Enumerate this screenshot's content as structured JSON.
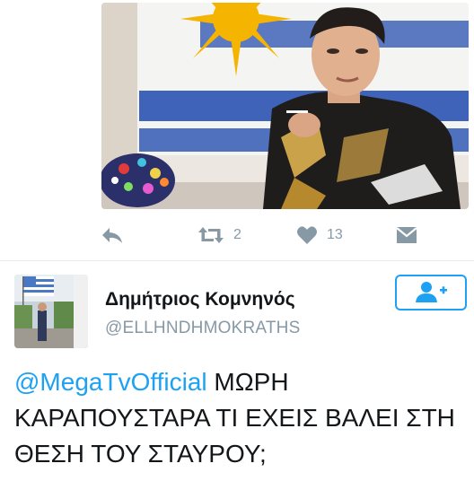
{
  "tweet_actions": {
    "retweet_count": "2",
    "like_count": "13"
  },
  "next_tweet": {
    "display_name": "Δημήτριος Κομνηνός",
    "handle": "@ELLHNDHMOKRATHS",
    "mention": "@MegaTvOfficial",
    "text": " ΜΩΡΗ ΚΑΡΑΠΟΥΣΤΑΡΑ ΤΙ ΕΧΕΙΣ ΒΑΛΕΙ ΣΤΗ ΘΕΣΗ ΤΟΥ ΣΤΑΥΡΟΥ;"
  },
  "icons": {
    "reply": "reply-icon",
    "retweet": "retweet-icon",
    "like": "heart-icon",
    "dm": "direct-message-icon",
    "follow": "add-user-icon"
  },
  "colors": {
    "accent": "#1da1f2",
    "action_gray": "#8899a6",
    "text": "#14171a"
  }
}
